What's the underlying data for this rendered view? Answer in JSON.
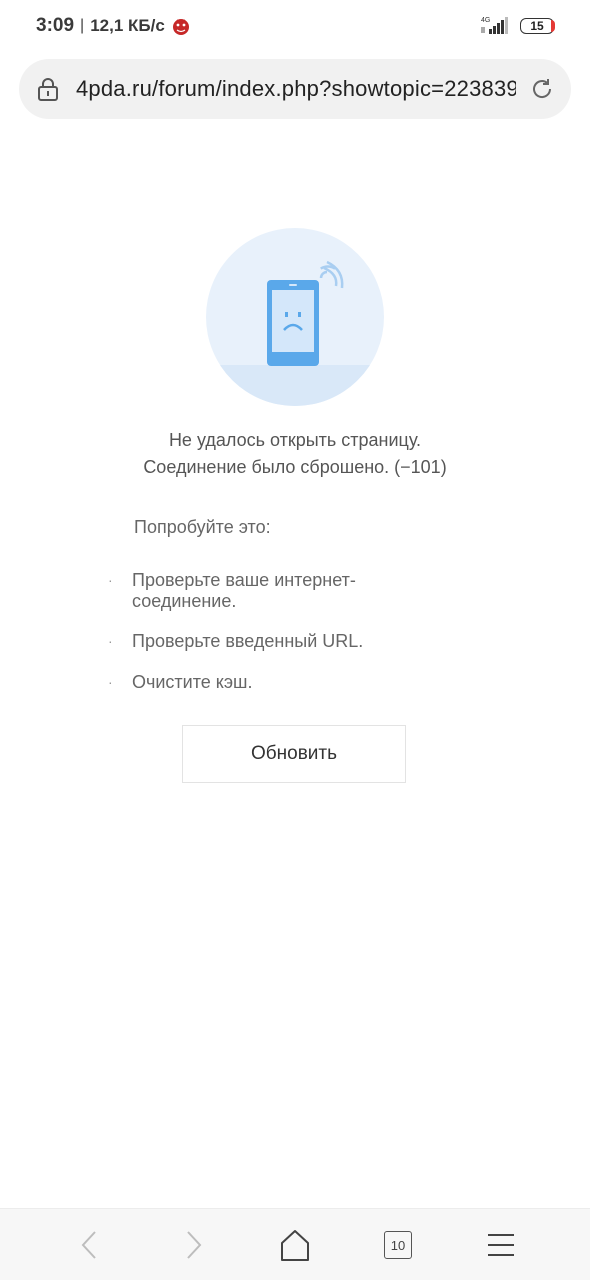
{
  "status_bar": {
    "time": "3:09",
    "separator": "|",
    "speed": "12,1 КБ/с",
    "network": "4G",
    "battery": "15"
  },
  "address_bar": {
    "url": "4pda.ru/forum/index.php?showtopic=223839"
  },
  "error": {
    "title": "Не удалось открыть страницу.",
    "subtitle": "Соединение было сброшено. (−101)",
    "try_heading": "Попробуйте это:",
    "tips": [
      "Проверьте ваше интернет-соединение.",
      "Проверьте введенный URL.",
      "Очистите кэш."
    ],
    "refresh_label": "Обновить"
  },
  "bottom_nav": {
    "tab_count": "10"
  },
  "colors": {
    "illustration_accent": "#5aa8ea",
    "illustration_bg": "#e8f1fb"
  }
}
